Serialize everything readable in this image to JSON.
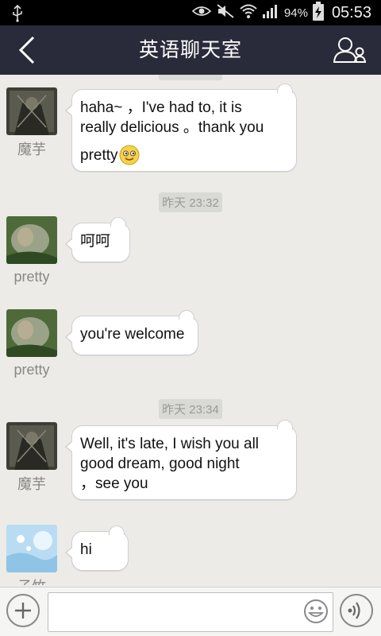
{
  "status_bar": {
    "battery": "94%",
    "time": "05:53"
  },
  "header": {
    "title": "英语聊天室"
  },
  "messages": [
    {
      "sender": "魔芋",
      "text_lines": [
        "haha~  ，I've had to, it is",
        "really delicious 。thank you",
        "pretty"
      ],
      "has_emoji": true
    },
    {
      "sender": "pretty",
      "text_lines": [
        "呵呵"
      ]
    },
    {
      "sender": "pretty",
      "text_lines": [
        "you're welcome"
      ]
    },
    {
      "sender": "魔芋",
      "text_lines": [
        "Well, it's late, I wish you all",
        "good dream, good night",
        "，see you"
      ]
    },
    {
      "sender": "子竹",
      "text_lines": [
        "hi"
      ]
    }
  ],
  "timestamps": [
    "昨天 23:32",
    "昨天 23:34"
  ],
  "input": {
    "value": "",
    "placeholder": ""
  }
}
